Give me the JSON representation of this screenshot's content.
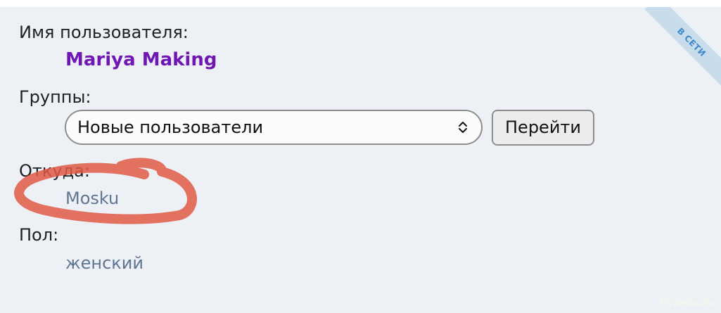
{
  "profile": {
    "online_badge": "В СЕТИ",
    "username_label": "Имя пользователя:",
    "username": "Mariya Making",
    "groups_label": "Группы:",
    "groups_selected": "Новые пользователи",
    "go_button": "Перейти",
    "location_label": "Откуда:",
    "location": "Mosku",
    "gender_label": "Пол:",
    "gender": "женский"
  },
  "colors": {
    "panel_bg": "#edf1f6",
    "username": "#7017b3",
    "value_text": "#5f7590",
    "badge_text": "#3f8bcd",
    "annotation_stroke": "#e05a45"
  },
  "icons": {
    "select_chevron": "chevron-up-down-icon"
  },
  "watermark": "MySeRos.Ru"
}
